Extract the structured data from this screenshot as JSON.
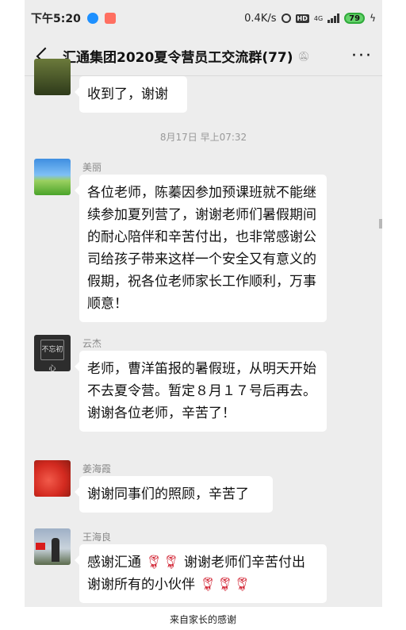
{
  "status_bar": {
    "time": "下午5:20",
    "speed": "0.4K/s",
    "network": "4G",
    "battery": "79"
  },
  "header": {
    "title": "汇通集团2020夏令营员工交流群(77)",
    "mute_icon": "mute-bell-icon",
    "more_icon": "more-icon"
  },
  "messages": [
    {
      "sender": "",
      "text": "收到了，谢谢"
    },
    {
      "sender": "美丽",
      "text": "各位老师，陈蓁因参加预课班就不能继续参加夏列营了，谢谢老师们暑假期间的耐心陪伴和辛苦付出，也非常感谢公司给孩子带来这样一个安全又有意义的假期，祝各位老师家长工作顺利，万事顺意！"
    },
    {
      "sender": "云杰",
      "text": "老师，曹洋笛报的暑假班，从明天开始不去夏令营。暂定８月１７号后再去。谢谢各位老师，辛苦了！",
      "avatar_text": "不忘初心"
    },
    {
      "sender": "姜海霞",
      "text": "谢谢同事们的照顾，辛苦了"
    },
    {
      "sender": "王海良",
      "text_part1": "感谢汇通",
      "text_part2": "谢谢老师们辛苦付出 谢谢所有的小伙伴",
      "emoji": "rose"
    }
  ],
  "timestamp": "8月17日 早上07:32",
  "caption": "来自家长的感谢"
}
